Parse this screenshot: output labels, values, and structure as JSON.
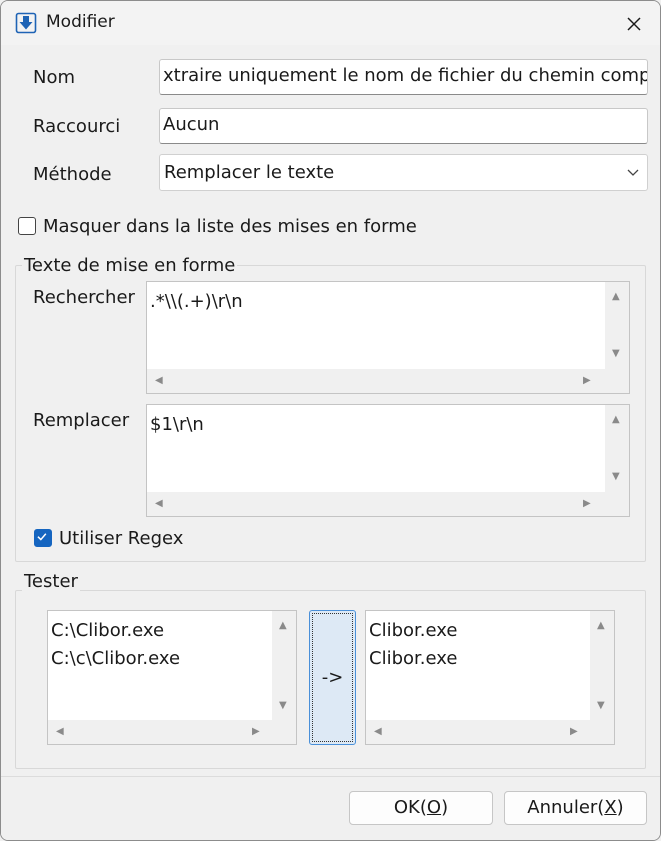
{
  "window": {
    "title": "Modifier"
  },
  "form": {
    "nom_label": "Nom",
    "nom_value": "xtraire uniquement le nom de fichier du chemin complet",
    "raccourci_label": "Raccourci",
    "raccourci_value": "Aucun",
    "methode_label": "Méthode",
    "methode_value": "Remplacer le texte",
    "hide_label": "Masquer dans la liste des mises en forme",
    "hide_checked": false
  },
  "format_group": {
    "title": "Texte de mise en forme",
    "search_label": "Rechercher",
    "search_value": ".*\\\\(.+)\\r\\n",
    "replace_label": "Remplacer",
    "replace_value": "$1\\r\\n",
    "regex_label": "Utiliser Regex",
    "regex_checked": true
  },
  "tester": {
    "title": "Tester",
    "input": "C:\\Clibor.exe\nC:\\c\\Clibor.exe",
    "run_label": "->",
    "output": "Clibor.exe\nClibor.exe"
  },
  "buttons": {
    "ok_pre": "OK(",
    "ok_key": "O",
    "ok_post": ")",
    "cancel_pre": "Annuler(",
    "cancel_key": "X",
    "cancel_post": ")"
  },
  "colors": {
    "accent": "#1565c0",
    "run_button_bg": "#dde9f5",
    "icon_blue": "#1e63b5"
  }
}
